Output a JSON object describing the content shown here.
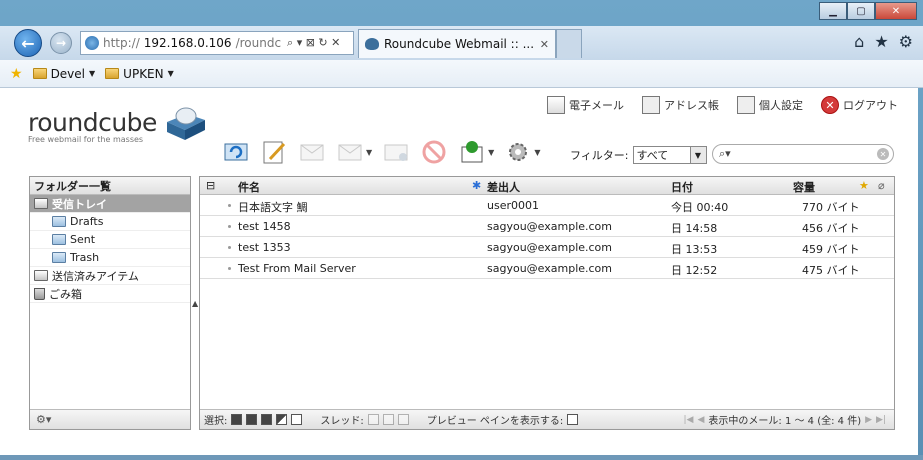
{
  "browser": {
    "address": {
      "prefix": "http://",
      "host": "192.168.0.106",
      "path": "/roundc",
      "controls": "⌕ ▾ ⊠ ↻ ✕"
    },
    "tab": {
      "title": "Roundcube Webmail :: ...",
      "close": "✕"
    },
    "toolbar_icons": [
      "home-icon",
      "favorites-star-icon",
      "settings-gear-icon"
    ],
    "favorites": [
      {
        "label": "Devel"
      },
      {
        "label": "UPKEN"
      }
    ]
  },
  "app": {
    "logo_text": "roundcube",
    "logo_subtitle": "Free webmail for the masses",
    "topnav": {
      "mail": "電子メール",
      "addressbook": "アドレス帳",
      "settings": "個人設定",
      "logout": "ログアウト"
    },
    "filter": {
      "label": "フィルター:",
      "value": "すべて"
    },
    "search": {
      "placeholder": ""
    }
  },
  "folders": {
    "header": "フォルダー一覧",
    "items": [
      {
        "label": "受信トレイ",
        "selected": true,
        "icon": "inbox-icon"
      },
      {
        "label": "Drafts",
        "sub": true,
        "icon": "folder-icon"
      },
      {
        "label": "Sent",
        "sub": true,
        "icon": "folder-icon"
      },
      {
        "label": "Trash",
        "sub": true,
        "icon": "folder-icon"
      },
      {
        "label": "送信済みアイテム",
        "icon": "sent-items-icon"
      },
      {
        "label": "ごみ箱",
        "icon": "trash-icon"
      }
    ],
    "footer_menu": "⚙▾"
  },
  "messages": {
    "columns": {
      "subject": "件名",
      "from": "差出人",
      "date": "日付",
      "size": "容量"
    },
    "rows": [
      {
        "subject": "日本語文字 鯛",
        "from": "user0001",
        "date": "今日 00:40",
        "size": "770 バイト"
      },
      {
        "subject": "test 1458",
        "from": "sagyou@example.com",
        "date": "日 14:58",
        "size": "456 バイト"
      },
      {
        "subject": "test 1353",
        "from": "sagyou@example.com",
        "date": "日 13:53",
        "size": "459 バイト"
      },
      {
        "subject": "Test From Mail Server",
        "from": "sagyou@example.com",
        "date": "日 12:52",
        "size": "475 バイト"
      }
    ],
    "footer": {
      "select_label": "選択:",
      "thread_label": "スレッド:",
      "preview_label": "プレビュー ペインを表示する:",
      "count_text": "表示中のメール: 1 〜 4 (全: 4 件)"
    }
  }
}
